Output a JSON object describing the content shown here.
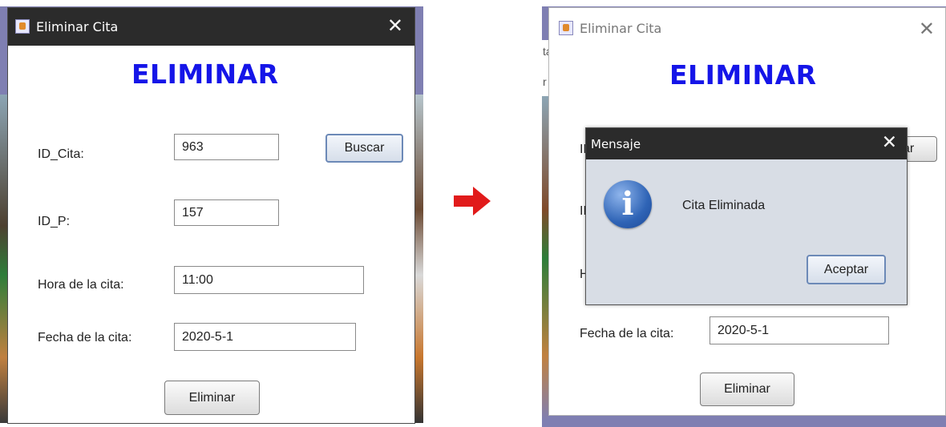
{
  "left_window": {
    "title": "Eliminar Cita",
    "close_glyph": "✕",
    "heading": "ELIMINAR",
    "fields": {
      "id_cita": {
        "label": "ID_Cita:",
        "value": "963"
      },
      "id_p": {
        "label": "ID_P:",
        "value": "157"
      },
      "hora": {
        "label": "Hora de la cita:",
        "value": "11:00"
      },
      "fecha": {
        "label": "Fecha de la cita:",
        "value": "2020-5-1"
      }
    },
    "buscar_label": "Buscar",
    "eliminar_label": "Eliminar"
  },
  "right_window": {
    "title": "Eliminar Cita",
    "close_glyph": "✕",
    "heading": "ELIMINAR",
    "partial_labels": {
      "id_cita": "ID",
      "id_p": "ID",
      "hora": "H"
    },
    "partial_buscar": "ar",
    "fecha": {
      "label": "Fecha de la cita:",
      "value": "2020-5-1"
    },
    "eliminar_label": "Eliminar"
  },
  "dialog": {
    "title": "Mensaje",
    "close_glyph": "✕",
    "icon_glyph": "i",
    "message": "Cita Eliminada",
    "accept_label": "Aceptar"
  },
  "background_fragments": [
    "ta",
    "r"
  ],
  "colors": {
    "heading": "#1515e8",
    "titlebar": "#2b2b2b",
    "arrow": "#e11b1b",
    "backdrop": "#7f7fb2"
  },
  "icons": [
    "java-app-icon",
    "close-icon",
    "info-icon",
    "arrow-right-icon"
  ]
}
